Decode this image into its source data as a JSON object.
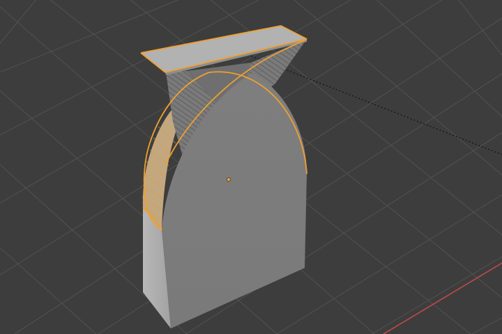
{
  "viewport": {
    "background_color": "#3d3d3d",
    "grid_line_color": "#545454",
    "x_axis_color": "#c84a4a",
    "selection_outline_color": "#f0a030",
    "origin_dot_color": "#f0a030",
    "mesh_face_color": "#8a8a8a",
    "mesh_side_color": "#a8a8a8",
    "mesh_top_color": "#b4b4b4",
    "relationship_line_color": "#111111"
  },
  "scene": {
    "object_type": "mesh",
    "selected": true,
    "origin_marker_visible": true,
    "relationship_line_visible": true,
    "grid_visible": true,
    "x_axis_visible": true
  }
}
